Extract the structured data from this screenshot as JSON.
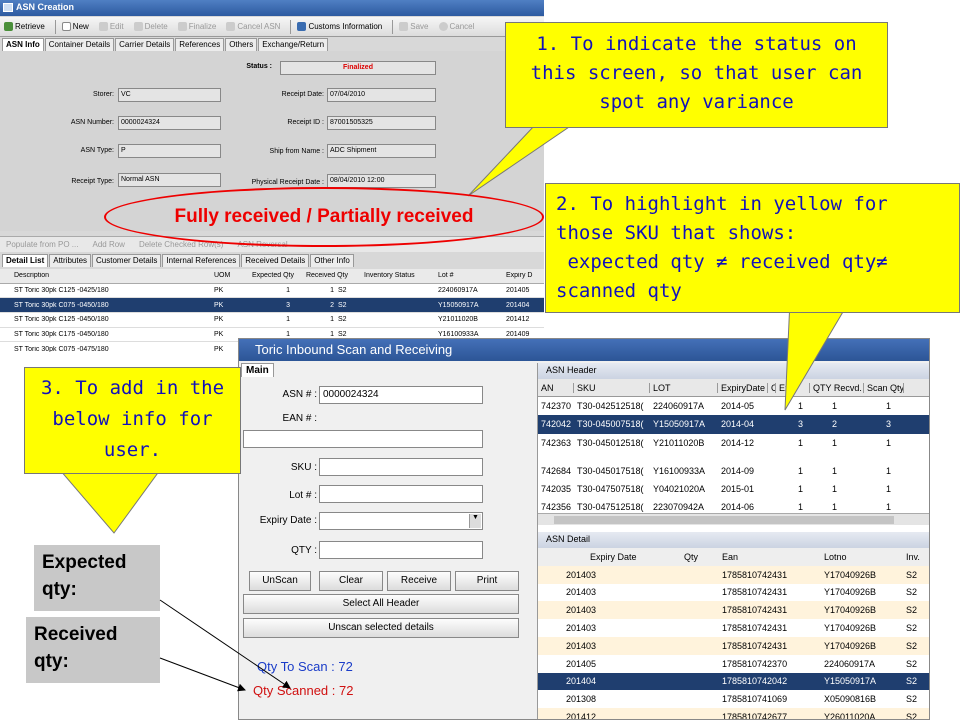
{
  "asn_window": {
    "title": "ASN Creation",
    "toolbar": [
      {
        "label": "Retrieve",
        "enabled": true
      },
      {
        "label": "New",
        "enabled": true
      },
      {
        "label": "Edit",
        "enabled": false
      },
      {
        "label": "Delete",
        "enabled": false
      },
      {
        "label": "Finalize",
        "enabled": false
      },
      {
        "label": "Cancel ASN",
        "enabled": false
      },
      {
        "label": "Customs Information",
        "enabled": true
      },
      {
        "label": "Save",
        "enabled": false
      },
      {
        "label": "Cancel",
        "enabled": false
      }
    ],
    "tabs": [
      "ASN Info",
      "Container Details",
      "Carrier Details",
      "References",
      "Others",
      "Exchange/Return"
    ],
    "status_label": "Status :",
    "status_value": "Finalized",
    "fields": {
      "storer": {
        "label": "Storer:",
        "value": "VC"
      },
      "asn_number": {
        "label": "ASN Number:",
        "value": "0000024324"
      },
      "asn_type": {
        "label": "ASN Type:",
        "value": "P"
      },
      "receipt_type": {
        "label": "Receipt Type:",
        "value": "Normal ASN"
      },
      "receipt_date": {
        "label": "Receipt Date:",
        "value": "07/04/2010"
      },
      "receipt_id": {
        "label": "Receipt ID :",
        "value": "87001505325"
      },
      "ship_from": {
        "label": "Ship from Name :",
        "value": "ADC Shipment"
      },
      "physical_receipt": {
        "label": "Physical Receipt Date :",
        "value": "08/04/2010 12:00"
      }
    },
    "ghost_toolbar": [
      "Populate from PO ...",
      "Add Row",
      "Delete Checked Row(s)",
      "ASN Reversal"
    ],
    "detail_tabs": [
      "Detail List",
      "Attributes",
      "Customer Details",
      "Internal References",
      "Received Details",
      "Other Info"
    ],
    "grid": {
      "columns": [
        "Description",
        "UOM",
        "Expected Qty",
        "Received Qty",
        "Inventory Status",
        "Lot #",
        "Expiry D"
      ],
      "rows": [
        [
          "ST Toric 30pk C125 -0425/180",
          "PK",
          "1",
          "1",
          "S2",
          "224060917A",
          "201405"
        ],
        [
          "ST Toric 30pk C075 -0450/180",
          "PK",
          "3",
          "2",
          "S2",
          "Y15050917A",
          "201404"
        ],
        [
          "ST Toric 30pk C125 -0450/180",
          "PK",
          "1",
          "1",
          "S2",
          "Y21011020B",
          "201412"
        ],
        [
          "ST Toric 30pk C175 -0450/180",
          "PK",
          "1",
          "1",
          "S2",
          "Y16100933A",
          "201409"
        ],
        [
          "ST Toric 30pk C075 -0475/180",
          "PK",
          "1",
          "1",
          "S2",
          "",
          ""
        ]
      ],
      "selected_row": 1
    }
  },
  "annotations": {
    "ellipse_text": "Fully received / Partially received",
    "callout1": [
      "1. To indicate the status on",
      "this screen, so that user can",
      "spot any variance"
    ],
    "callout2": [
      "2. To highlight in yellow for",
      "those SKU that shows:",
      " expected qty ≠ received qty≠",
      "scanned qty"
    ],
    "callout3": [
      "3. To add in the",
      "below info for",
      "user."
    ],
    "box_expected": [
      "Expected",
      "qty:"
    ],
    "box_received": [
      "Received",
      "qty:"
    ]
  },
  "scan_window": {
    "title": "Toric Inbound Scan and Receiving",
    "tab": "Main",
    "asn_label": "ASN # :",
    "asn_value": "0000024324",
    "ean_label": "EAN # :",
    "sku_label": "SKU :",
    "lot_label": "Lot # :",
    "expiry_label": "Expiry Date :",
    "qty_label": "QTY :",
    "buttons": {
      "unscan": "UnScan",
      "clear": "Clear",
      "receive": "Receive",
      "print": "Print",
      "select_all": "Select All Header",
      "unscan_selected": "Unscan selected details"
    },
    "qty_to_scan_label": "Qty To Scan :",
    "qty_to_scan": "72",
    "qty_scanned_label": "Qty Scanned :",
    "qty_scanned": "72",
    "asn_header": {
      "title": "ASN Header",
      "columns": [
        "AN",
        "SKU",
        "LOT",
        "ExpiryDate",
        "C",
        "Exp.",
        "QTY Recvd.",
        "Scan Qty"
      ],
      "rows": [
        [
          "742370",
          "T30-042512518(",
          "224060917A",
          "2014-05",
          "",
          "1",
          "1",
          "1"
        ],
        [
          "742042",
          "T30-045007518(",
          "Y15050917A",
          "2014-04",
          "",
          "3",
          "2",
          "3"
        ],
        [
          "742363",
          "T30-045012518(",
          "Y21011020B",
          "2014-12",
          "",
          "1",
          "1",
          "1"
        ],
        [
          "742684",
          "T30-045017518(",
          "Y16100933A",
          "2014-09",
          "",
          "1",
          "1",
          "1"
        ],
        [
          "742035",
          "T30-047507518(",
          "Y04021020A",
          "2015-01",
          "",
          "1",
          "1",
          "1"
        ],
        [
          "742356",
          "T30-047512518(",
          "223070942A",
          "2014-06",
          "",
          "1",
          "1",
          "1"
        ]
      ],
      "selected_row": 1
    },
    "asn_detail": {
      "title": "ASN Detail",
      "columns": [
        "Expiry Date",
        "Qty",
        "Ean",
        "Lotno",
        "Inv."
      ],
      "rows": [
        [
          "201403",
          "",
          "1785810742431",
          "Y17040926B",
          "S2"
        ],
        [
          "201403",
          "",
          "1785810742431",
          "Y17040926B",
          "S2"
        ],
        [
          "201403",
          "",
          "1785810742431",
          "Y17040926B",
          "S2"
        ],
        [
          "201403",
          "",
          "1785810742431",
          "Y17040926B",
          "S2"
        ],
        [
          "201403",
          "",
          "1785810742431",
          "Y17040926B",
          "S2"
        ],
        [
          "201405",
          "",
          "1785810742370",
          "224060917A",
          "S2"
        ],
        [
          "201404",
          "",
          "1785810742042",
          "Y15050917A",
          "S2"
        ],
        [
          "201308",
          "",
          "1785810741069",
          "X05090816B",
          "S2"
        ],
        [
          "201412",
          "",
          "1785810742677",
          "Y26011020A",
          "S2"
        ]
      ],
      "selected_row": 6
    }
  }
}
